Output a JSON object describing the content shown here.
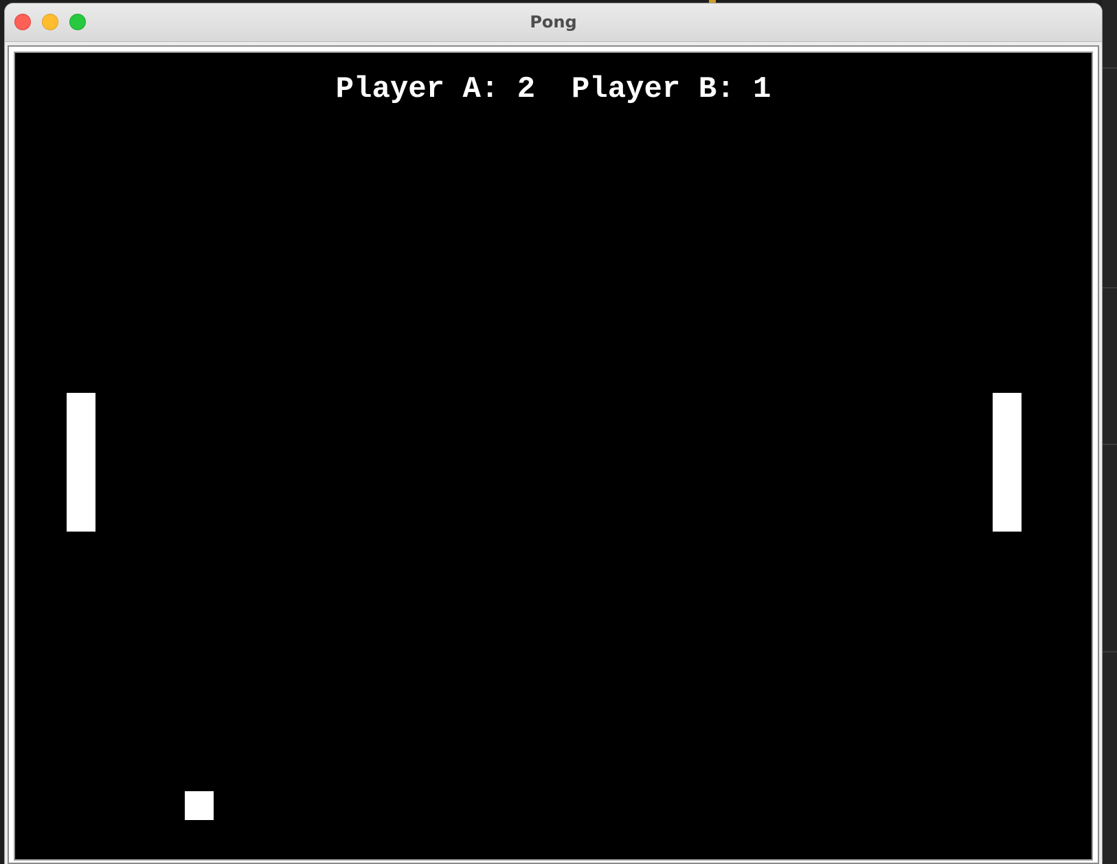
{
  "window": {
    "title": "Pong"
  },
  "scoreboard": {
    "player_a_label": "Player A:",
    "player_a_score": "2",
    "player_b_label": "Player B:",
    "player_b_score": "1"
  },
  "colors": {
    "canvas_background": "#000000",
    "game_objects": "#ffffff",
    "close_button": "#fe5f57",
    "minimize_button": "#febc2e",
    "maximize_button": "#28c840"
  }
}
